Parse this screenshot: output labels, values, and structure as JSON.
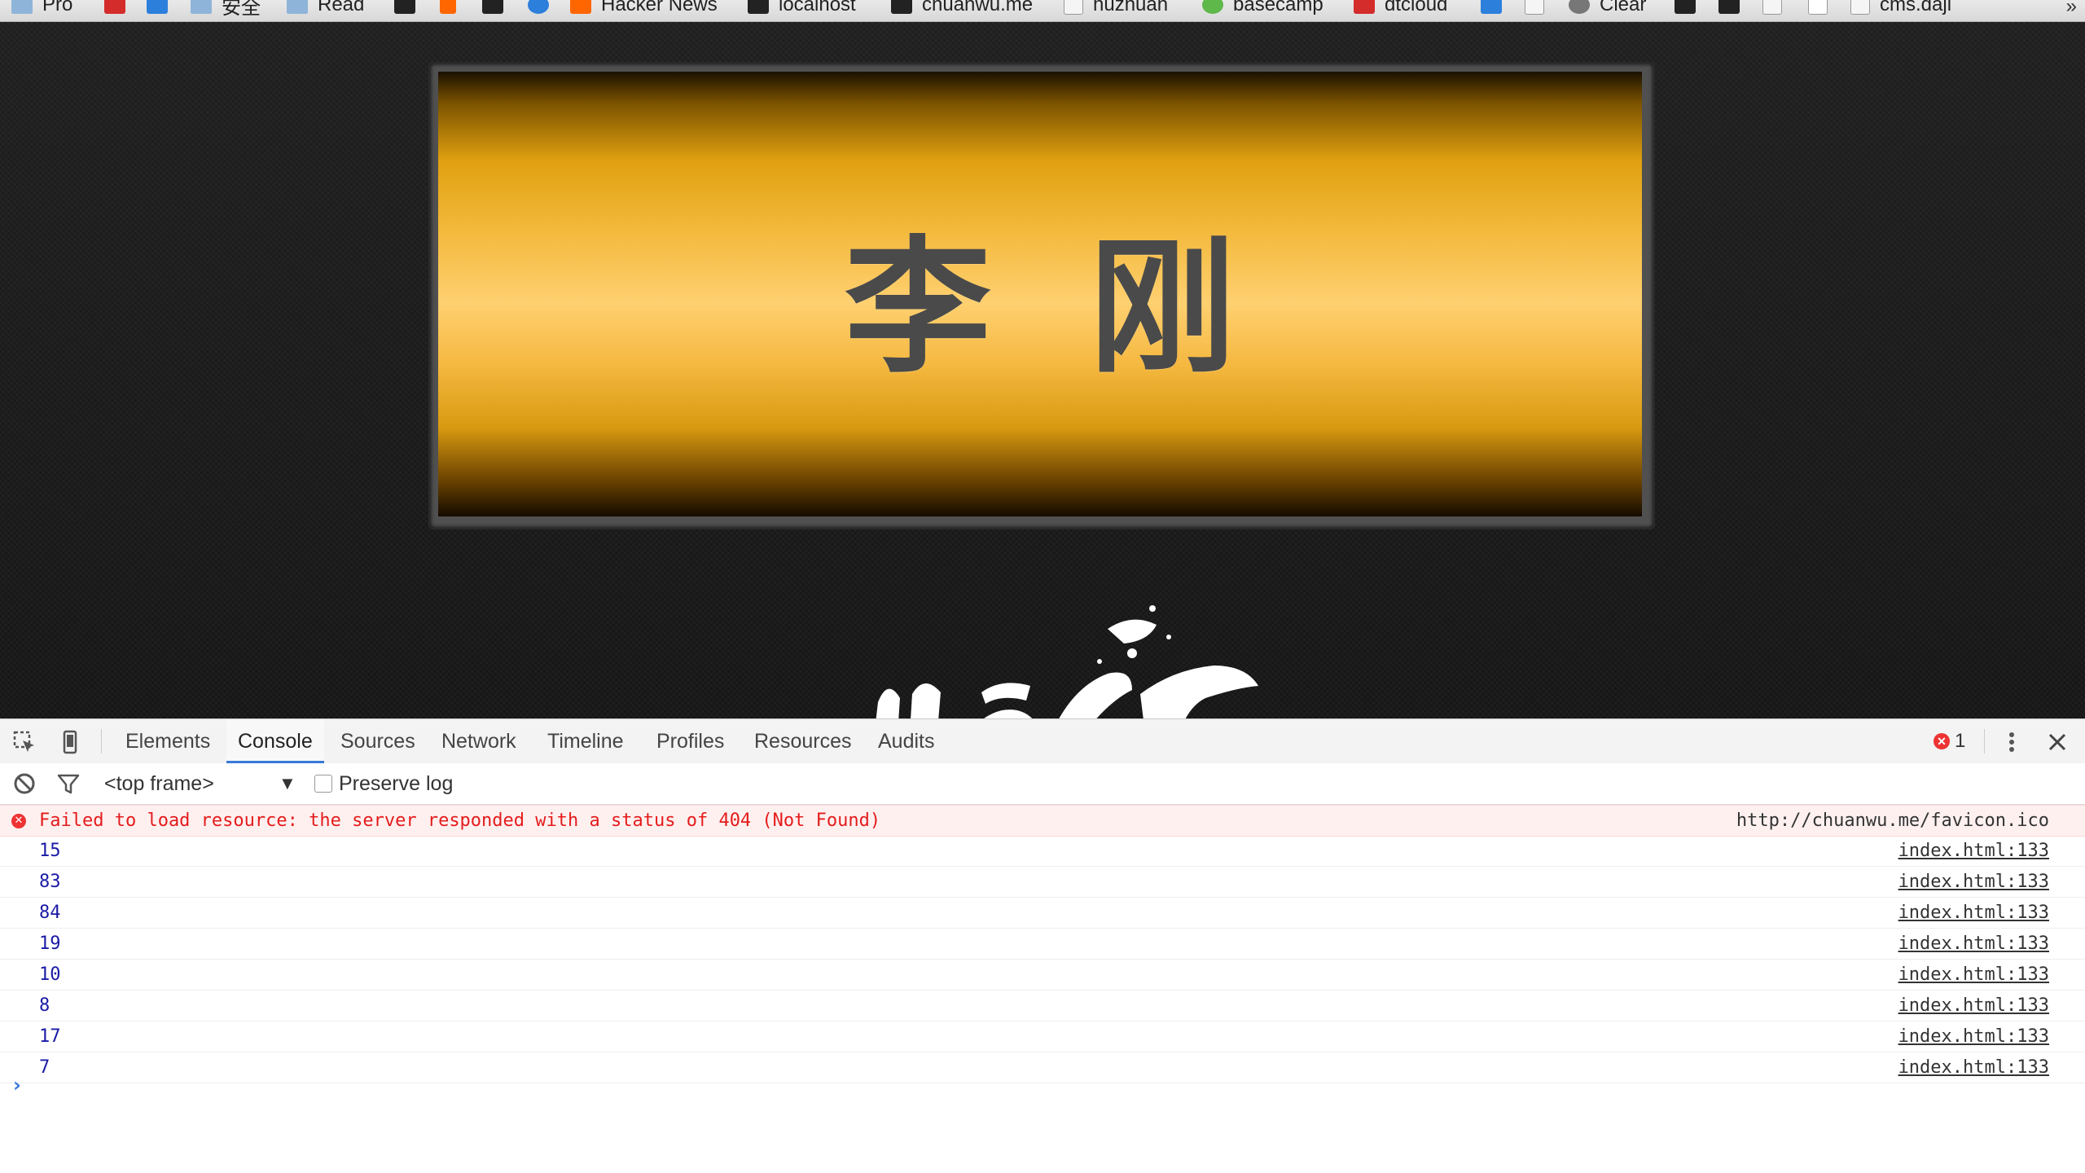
{
  "bookmarks": {
    "items": [
      {
        "label": "Pro",
        "icon": "folder-icon"
      },
      {
        "label": "",
        "icon": "weibo-icon"
      },
      {
        "label": "",
        "icon": "checkbox-app-icon"
      },
      {
        "label": "安全",
        "icon": "folder-icon"
      },
      {
        "label": "Read",
        "icon": "folder-icon"
      },
      {
        "label": "",
        "icon": "g-app-icon"
      },
      {
        "label": "",
        "icon": "stack-icon"
      },
      {
        "label": "",
        "icon": "chart-app-icon"
      },
      {
        "label": "",
        "icon": "ie-icon"
      },
      {
        "label": "Hacker News",
        "icon": "ycombinator-icon"
      },
      {
        "label": "localhost",
        "icon": "dark-site-icon"
      },
      {
        "label": "chuanwu.me",
        "icon": "chart-app-icon"
      },
      {
        "label": "huzhuan",
        "icon": "page-icon"
      },
      {
        "label": "basecamp",
        "icon": "basecamp-icon"
      },
      {
        "label": "dtcloud",
        "icon": "dtcloud-icon"
      },
      {
        "label": "",
        "icon": "fm-icon"
      },
      {
        "label": "",
        "icon": "wikipedia-icon"
      },
      {
        "label": "Clear",
        "icon": "gear-icon"
      },
      {
        "label": "",
        "icon": "terminal-icon"
      },
      {
        "label": "",
        "icon": "dark-site-icon"
      },
      {
        "label": "",
        "icon": "page-icon"
      },
      {
        "label": "",
        "icon": "blank-page-icon"
      },
      {
        "label": "cms.daji",
        "icon": "page-icon"
      }
    ],
    "more": "»"
  },
  "page": {
    "plaque_name": "李刚"
  },
  "devtools": {
    "tabs": [
      "Elements",
      "Console",
      "Sources",
      "Network",
      "Timeline",
      "Profiles",
      "Resources",
      "Audits"
    ],
    "active_tab": "Console",
    "error_count": "1",
    "frame_select": "<top frame>",
    "preserve_log_label": "Preserve log",
    "messages": [
      {
        "type": "error",
        "text": "Failed to load resource: the server responded with a status of 404 (Not Found)",
        "source": "http://chuanwu.me/favicon.ico"
      },
      {
        "type": "log",
        "text": "15",
        "source": "index.html:133"
      },
      {
        "type": "log",
        "text": "83",
        "source": "index.html:133"
      },
      {
        "type": "log",
        "text": "84",
        "source": "index.html:133"
      },
      {
        "type": "log",
        "text": "19",
        "source": "index.html:133"
      },
      {
        "type": "log",
        "text": "10",
        "source": "index.html:133"
      },
      {
        "type": "log",
        "text": "8",
        "source": "index.html:133"
      },
      {
        "type": "log",
        "text": "17",
        "source": "index.html:133"
      },
      {
        "type": "log",
        "text": "7",
        "source": "index.html:133"
      }
    ],
    "prompt": "›"
  },
  "colors": {
    "accent": "#3879d9",
    "error": "#e41c1c",
    "plaque_gold": "#ffd070",
    "number": "#1a1aa6"
  }
}
